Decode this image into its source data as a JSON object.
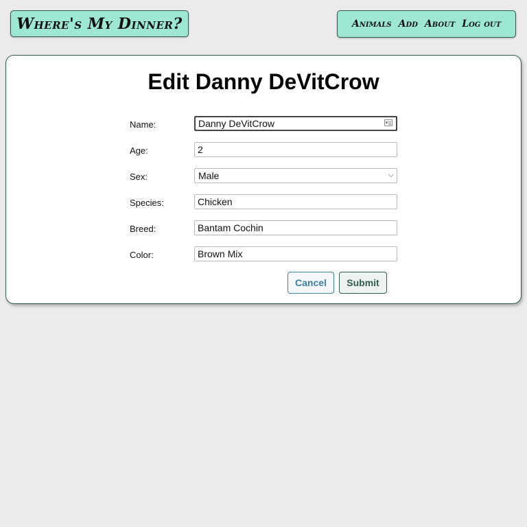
{
  "header": {
    "brand": "Where's My Dinner?",
    "nav": [
      "Animals",
      "Add",
      "About",
      "Log out"
    ]
  },
  "form": {
    "title": "Edit Danny DeVitCrow",
    "fields": {
      "name": {
        "label": "Name:",
        "value": "Danny DeVitCrow"
      },
      "age": {
        "label": "Age:",
        "value": "2"
      },
      "sex": {
        "label": "Sex:",
        "value": "Male"
      },
      "species": {
        "label": "Species:",
        "value": "Chicken"
      },
      "breed": {
        "label": "Breed:",
        "value": "Bantam Cochin"
      },
      "color": {
        "label": "Color:",
        "value": "Brown Mix"
      }
    },
    "buttons": {
      "cancel": "Cancel",
      "submit": "Submit"
    }
  },
  "colors": {
    "header_bg": "#9ee8d3",
    "accent": "#2e5b4f",
    "cancel_accent": "#3a7fa2",
    "page_bg": "#ebebeb"
  },
  "icons": {
    "name_field_icon": "autofill-contact-card-icon",
    "sex_select_icon": "chevron-down-icon"
  }
}
